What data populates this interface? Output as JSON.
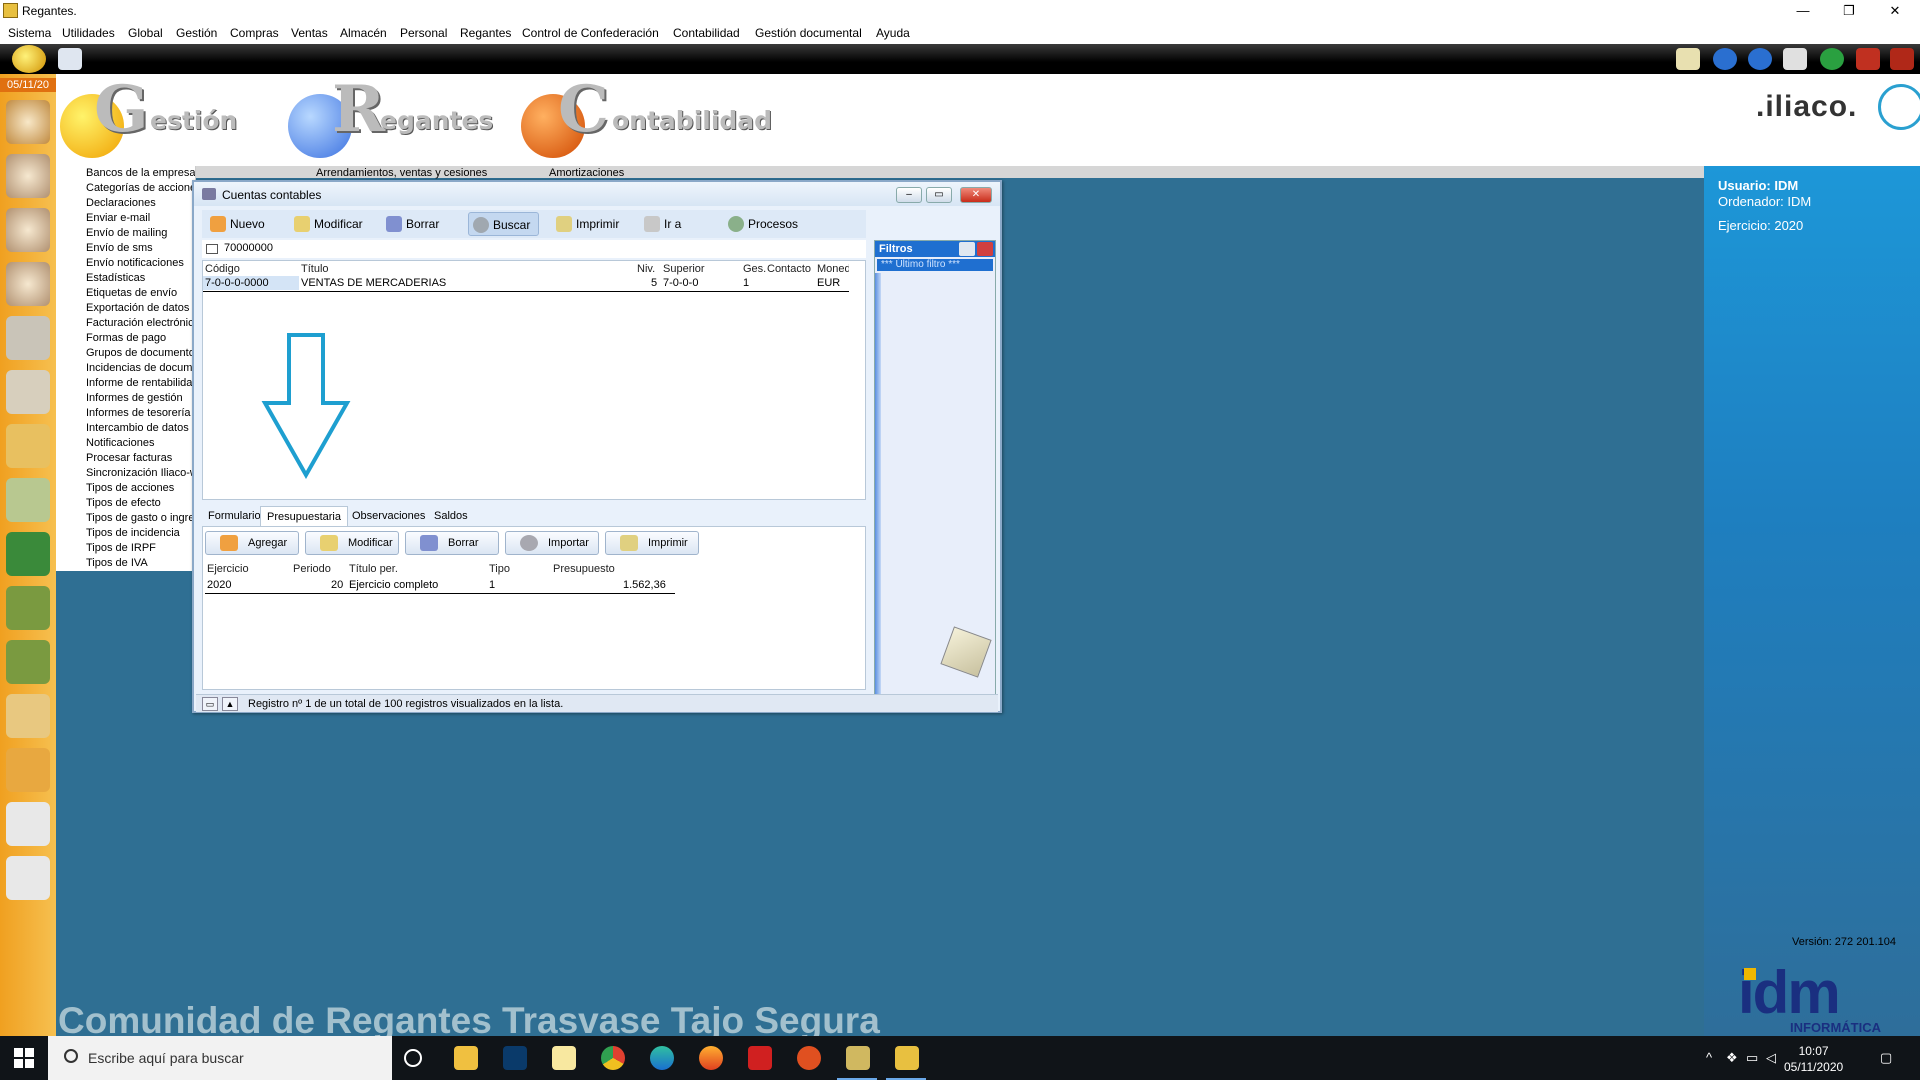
{
  "window": {
    "title": "Regantes.",
    "controls": [
      "—",
      "❐",
      "✕"
    ]
  },
  "menu": [
    "Sistema",
    "Utilidades",
    "Global",
    "Gestión",
    "Compras",
    "Ventas",
    "Almacén",
    "Personal",
    "Regantes",
    "Control de Confederación",
    "Contabilidad",
    "Gestión documental",
    "Ayuda"
  ],
  "sidebar": {
    "date": "05/11/20"
  },
  "header": {
    "brands": [
      {
        "big": "G",
        "rest": "estión"
      },
      {
        "big": "R",
        "rest": "egantes"
      },
      {
        "big": "C",
        "rest": "ontabilidad"
      }
    ],
    "logo": ".iliaco."
  },
  "menu_list": [
    "Bancos de la empresa",
    "Categorías de acciones",
    "Declaraciones",
    "Enviar e-mail",
    "Envío de mailing",
    "Envío de sms",
    "Envío notificaciones",
    "Estadísticas",
    "Etiquetas de envío",
    "Exportación de datos a",
    "Facturación electrónica",
    "Formas de pago",
    "Grupos de documentos",
    "Incidencias de documentos",
    "Informe de rentabilidad",
    "Informes de gestión",
    "Informes de tesorería",
    "Intercambio de datos",
    "Notificaciones",
    "Procesar facturas",
    "Sincronización Iliaco-w",
    "Tipos de acciones",
    "Tipos de efecto",
    "Tipos de gasto o ingreso",
    "Tipos de incidencia",
    "Tipos de IRPF",
    "Tipos de IVA"
  ],
  "col2_item": "Arrendamientos, ventas y cesiones",
  "col3_item": "Amortizaciones",
  "info": {
    "user": "Usuario: IDM",
    "computer": "Ordenador: IDM",
    "year": "Ejercicio: 2020",
    "version": "Versión: 272 201.104",
    "company_logo": "idm",
    "company_logo_sub": "INFORMÁTICA"
  },
  "community_name": "Comunidad de Regantes Trasvase Tajo Segura",
  "dialog": {
    "title": "Cuentas contables",
    "toolbar": [
      "Nuevo",
      "Modificar",
      "Borrar",
      "Buscar",
      "Imprimir",
      "Ir a",
      "Procesos"
    ],
    "search_value": "70000000",
    "columns": [
      "Código",
      "Título",
      "Niv.",
      "Superior",
      "Ges.",
      "Contacto",
      "Moneda"
    ],
    "row": {
      "codigo": "7-0-0-0-0000",
      "titulo": "VENTAS DE MERCADERIAS",
      "nivel": "5",
      "superior": "7-0-0-0",
      "ges": "1",
      "contacto": "",
      "moneda": "EUR"
    },
    "filters": {
      "title": "Filtros",
      "item": "*** Último filtro ***"
    },
    "tabs": [
      "Formulario",
      "Presupuestaria",
      "Observaciones",
      "Saldos"
    ],
    "active_tab": "Presupuestaria",
    "budget_toolbar": [
      "Agregar",
      "Modificar",
      "Borrar",
      "Importar",
      "Imprimir"
    ],
    "budget_columns": [
      "Ejercicio",
      "Periodo",
      "Título per.",
      "Tipo",
      "Presupuesto"
    ],
    "budget_row": {
      "ejercicio": "2020",
      "periodo": "20",
      "titulo": "Ejercicio completo",
      "tipo": "1",
      "presupuesto": "1.562,36"
    },
    "status": "Registro nº 1 de un total de 100 registros visualizados en la lista."
  },
  "taskbar": {
    "search_placeholder": "Escribe aquí para buscar",
    "time": "10:07",
    "date": "05/11/2020"
  },
  "colors": {
    "desktop": "#2f6f93",
    "accent": "#1f6fd0",
    "sidebar": "#f0a020"
  }
}
